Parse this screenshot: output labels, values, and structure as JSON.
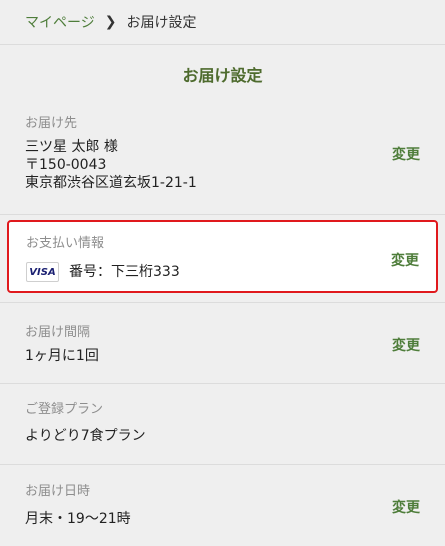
{
  "breadcrumb": {
    "home": "マイページ",
    "separator": "❯",
    "current": "お届け設定"
  },
  "page_title": "お届け設定",
  "change_label": "変更",
  "delivery_address": {
    "label": "お届け先",
    "name": "三ツ星 太郎 様",
    "postal": "〒150-0043",
    "address": "東京都渋谷区道玄坂1-21-1"
  },
  "payment": {
    "label": "お支払い情報",
    "card_brand": "VISA",
    "card_number": "番号：下三桁333",
    "highlight_color": "#e0191d"
  },
  "interval": {
    "label": "お届け間隔",
    "value": "1ヶ月に1回"
  },
  "plan": {
    "label": "ご登録プラン",
    "value": "よりどり7食プラン"
  },
  "datetime": {
    "label": "お届け日時",
    "value": "月末・19〜21時"
  },
  "colors": {
    "accent": "#4e7d3a",
    "title": "#4e6b2e",
    "background": "#efefef"
  }
}
